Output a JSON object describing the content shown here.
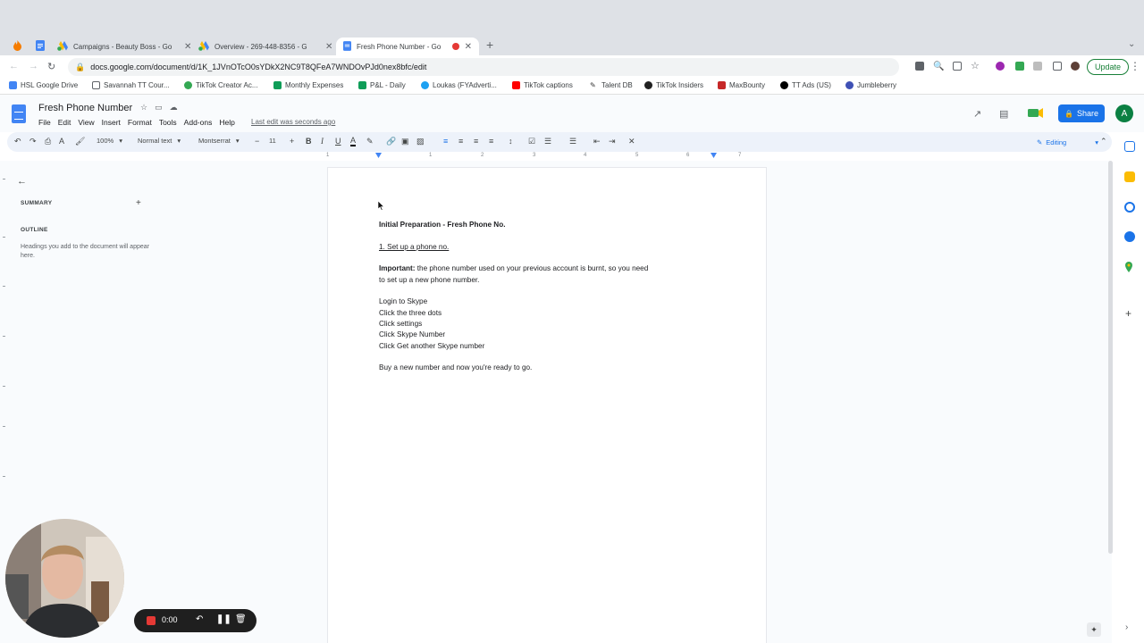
{
  "browser": {
    "tabs": [
      {
        "title": "Campaigns - Beauty Boss - Go",
        "icon": "google-ads-icon"
      },
      {
        "title": "Overview - 269-448-8356 - G",
        "icon": "google-ads-icon"
      },
      {
        "title": "Fresh Phone Number - Go",
        "icon": "google-docs-icon",
        "active": true
      }
    ],
    "url": "docs.google.com/document/d/1K_1JVnOTcO0sYDkX2NC9T8QFeA7WNDOvPJd0nex8bfc/edit",
    "update_label": "Update",
    "bookmarks": [
      "HSL Google Drive",
      "Savannah TT Cour...",
      "TikTok Creator Ac...",
      "Monthly Expenses",
      "P&L - Daily",
      "Loukas (FYAdverti...",
      "TikTok captions",
      "Talent DB",
      "TikTok Insiders",
      "MaxBounty",
      "TT Ads (US)",
      "Jumbleberry"
    ]
  },
  "docs": {
    "title": "Fresh Phone Number",
    "menu": [
      "File",
      "Edit",
      "View",
      "Insert",
      "Format",
      "Tools",
      "Add-ons",
      "Help"
    ],
    "last_edit": "Last edit was seconds ago",
    "share_label": "Share",
    "avatar_letter": "A",
    "toolbar": {
      "zoom": "100%",
      "style": "Normal text",
      "font": "Montserrat",
      "font_size": "11",
      "mode": "Editing"
    },
    "ruler_numbers": [
      "1",
      "1",
      "2",
      "3",
      "4",
      "5",
      "6",
      "7"
    ],
    "outline": {
      "summary_label": "SUMMARY",
      "outline_label": "OUTLINE",
      "hint": "Headings you add to the document will appear here."
    },
    "content": {
      "heading": "Initial Preparation - Fresh Phone No.",
      "step": "1. Set up a phone no.",
      "important_label": "Important:",
      "important_text_1": " the phone number used on your previous account is burnt, so you need",
      "important_text_2": "to set up a new phone number.",
      "steps": [
        "Login to Skype",
        "Click the three dots",
        "Click settings",
        "Click Skype Number",
        "Click Get another Skype number"
      ],
      "closing": "Buy a new number and now you're ready to go."
    }
  },
  "recorder": {
    "time": "0:00"
  },
  "colors": {
    "accent": "#1a73e8",
    "record": "#e53935",
    "update_green": "#188038"
  }
}
